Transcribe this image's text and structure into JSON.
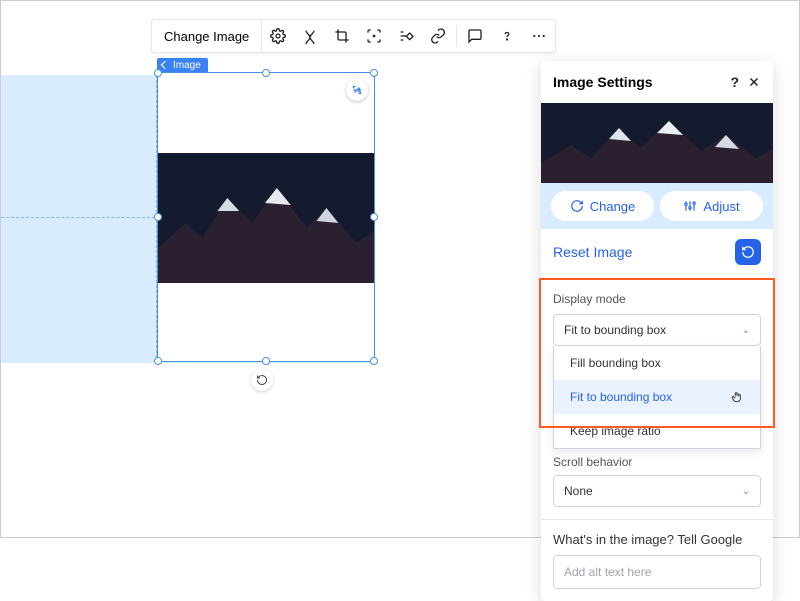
{
  "toolbar": {
    "change_image": "Change Image"
  },
  "badge": {
    "label": "Image"
  },
  "panel": {
    "title": "Image Settings",
    "change": "Change",
    "adjust": "Adjust",
    "reset": "Reset Image",
    "display_mode": {
      "label": "Display mode",
      "selected": "Fit to bounding box",
      "options": [
        "Fill bounding box",
        "Fit to bounding box",
        "Keep image ratio"
      ]
    },
    "scroll_behavior": {
      "label_truncated": "Scroll behavior",
      "value": "None"
    },
    "alt": {
      "label": "What's in the image? Tell Google",
      "placeholder": "Add alt text here"
    }
  }
}
